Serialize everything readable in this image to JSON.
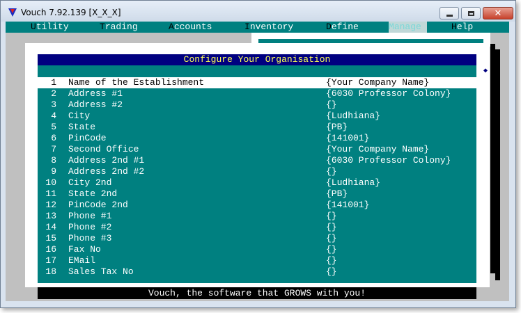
{
  "window": {
    "title": "Vouch  7.92.139  [X_X_X]",
    "colors": {
      "accent": "#008080",
      "title_bar": "#000080",
      "title_text": "#ffff55"
    }
  },
  "menu": [
    {
      "hotkey": "U",
      "rest": "tility",
      "name": "utility"
    },
    {
      "hotkey": "T",
      "rest": "rading",
      "name": "trading"
    },
    {
      "hotkey": "A",
      "rest": "ccounts",
      "name": "accounts"
    },
    {
      "hotkey": "I",
      "rest": "nventory",
      "name": "inventory"
    },
    {
      "hotkey": "D",
      "rest": "efine",
      "name": "define"
    },
    {
      "hotkey": "M",
      "rest": "anage",
      "name": "manage",
      "active": true
    },
    {
      "hotkey": "H",
      "rest": "elp",
      "name": "help"
    }
  ],
  "dialog": {
    "title": "Configure Your Organisation",
    "rows": [
      {
        "num": "1",
        "label": "Name of the Establishment",
        "value": "{Your Company Name}"
      },
      {
        "num": "2",
        "label": "Address #1",
        "value": "{6030 Professor Colony}"
      },
      {
        "num": "3",
        "label": "Address #2",
        "value": "{}"
      },
      {
        "num": "4",
        "label": "City",
        "value": "{Ludhiana}"
      },
      {
        "num": "5",
        "label": "State",
        "value": "{PB}"
      },
      {
        "num": "6",
        "label": "PinCode",
        "value": "{141001}"
      },
      {
        "num": "7",
        "label": "Second Office",
        "value": "{Your Company Name}"
      },
      {
        "num": "8",
        "label": "Address 2nd #1",
        "value": "{6030 Professor Colony}"
      },
      {
        "num": "9",
        "label": "Address 2nd #2",
        "value": "{}"
      },
      {
        "num": "10",
        "label": "City 2nd",
        "value": "{Ludhiana}"
      },
      {
        "num": "11",
        "label": "State 2nd",
        "value": "{PB}"
      },
      {
        "num": "12",
        "label": "PinCode 2nd",
        "value": "{141001}"
      },
      {
        "num": "13",
        "label": "Phone #1",
        "value": "{}"
      },
      {
        "num": "14",
        "label": "Phone #2",
        "value": "{}"
      },
      {
        "num": "15",
        "label": "Phone #3",
        "value": "{}"
      },
      {
        "num": "16",
        "label": "Fax No",
        "value": "{}"
      },
      {
        "num": "17",
        "label": "EMail",
        "value": "{}"
      },
      {
        "num": "18",
        "label": "Sales Tax No",
        "value": "{}"
      }
    ],
    "selected_index": 0
  },
  "status": "Vouch, the software that GROWS with you!",
  "icons": {
    "app": "vouch-logo-icon",
    "minimize": "minimize-icon",
    "maximize": "maximize-icon",
    "close": "close-icon",
    "scroll": "diamond-icon"
  }
}
